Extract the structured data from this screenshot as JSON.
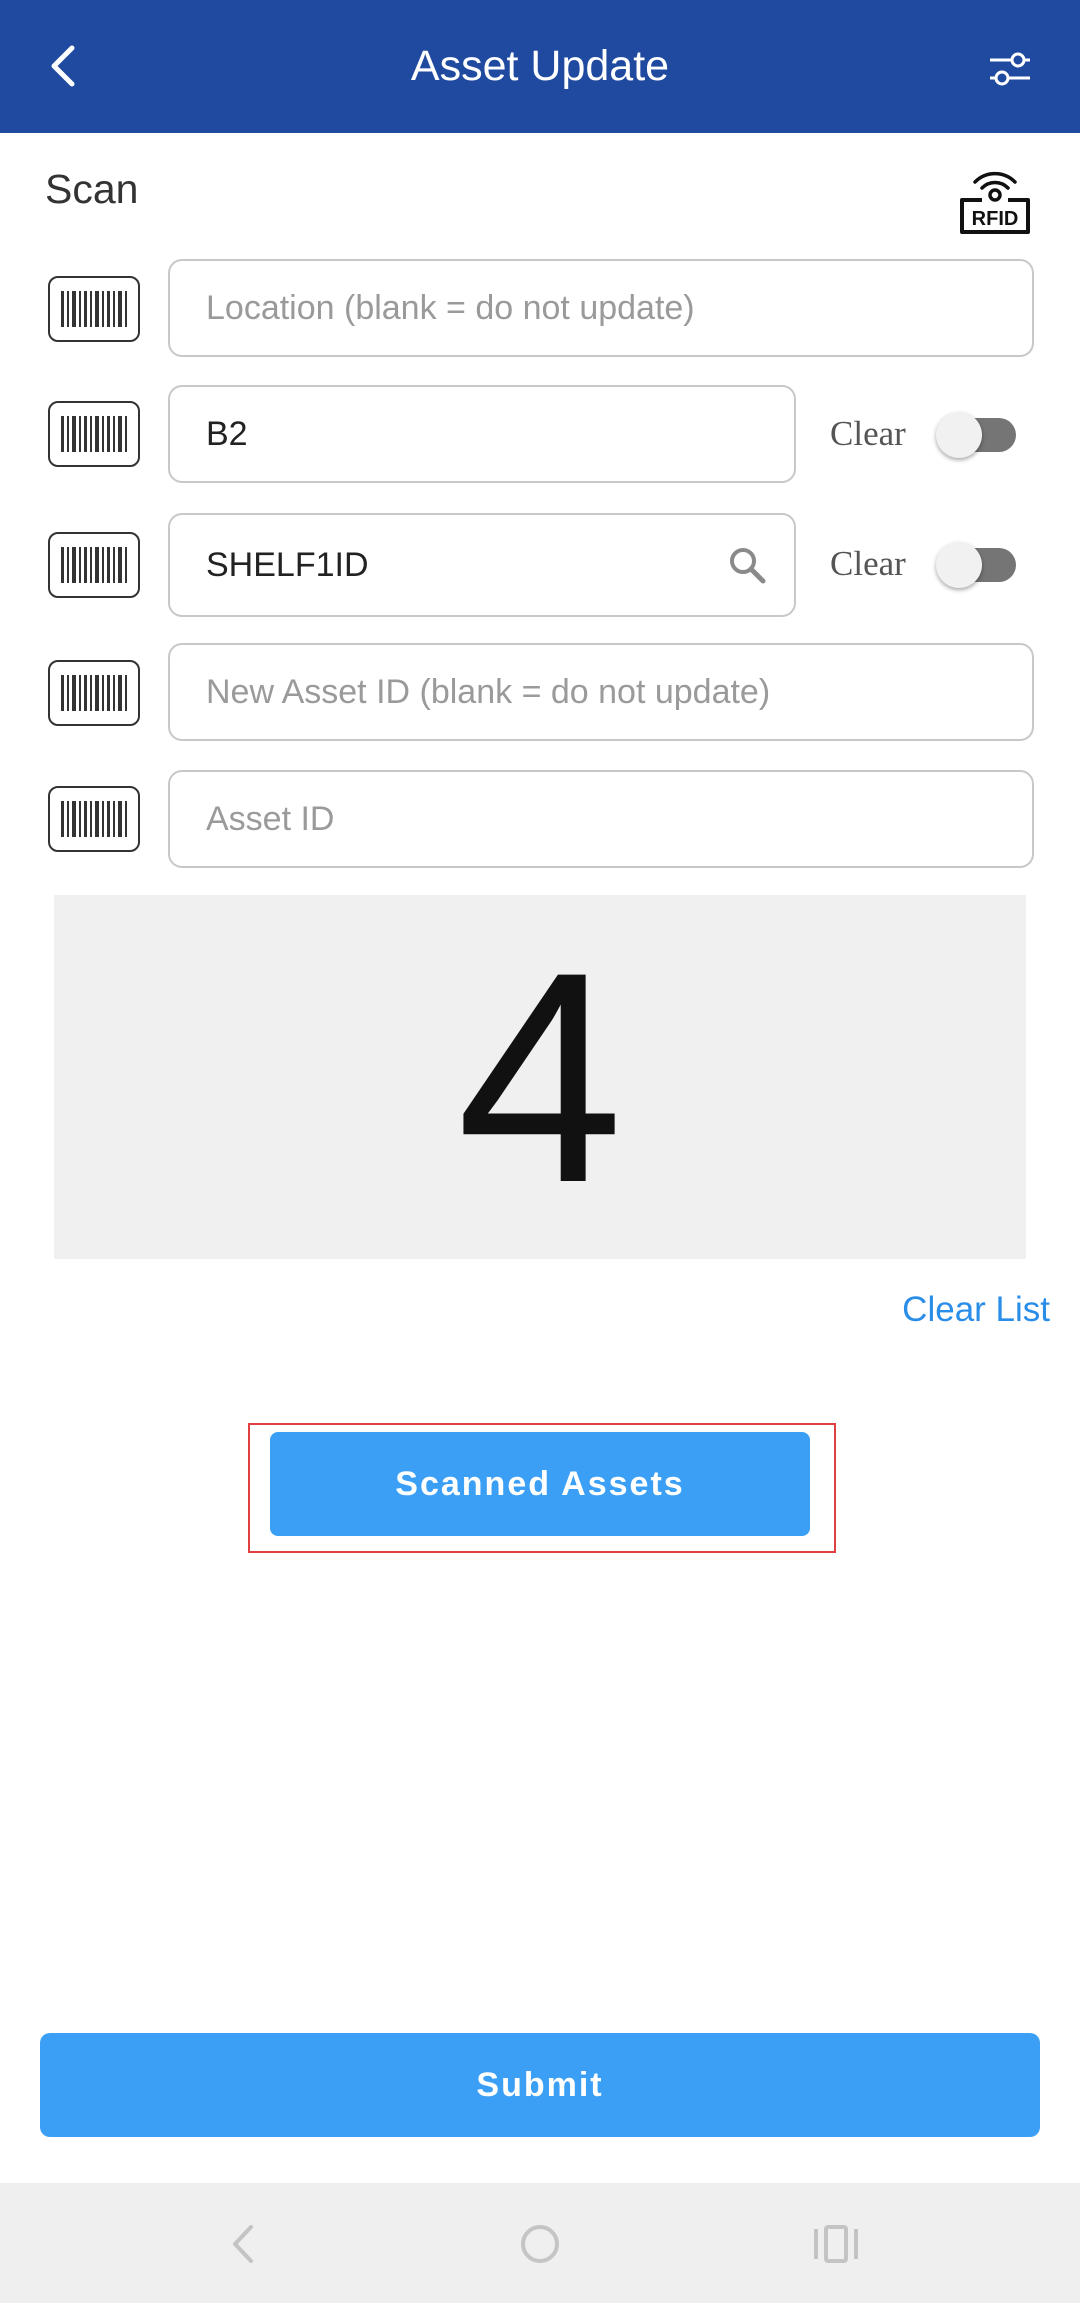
{
  "header": {
    "title": "Asset Update",
    "back_icon": "chevron-left-icon",
    "filter_icon": "sliders-icon",
    "background": "#1f4aa0"
  },
  "scan": {
    "label": "Scan",
    "rfid_icon": "rfid-icon",
    "rfid_text": "RFID"
  },
  "fields": {
    "location": {
      "placeholder": "Location (blank = do not update)",
      "value": ""
    },
    "sub_location": {
      "value": "B2",
      "clear_label": "Clear",
      "clear_toggle": false
    },
    "shelf": {
      "value": "SHELF1ID",
      "clear_label": "Clear",
      "clear_toggle": false
    },
    "new_asset": {
      "placeholder": "New Asset ID (blank = do not update)",
      "value": ""
    },
    "asset": {
      "placeholder": "Asset ID",
      "value": ""
    }
  },
  "counter": {
    "value": "4"
  },
  "actions": {
    "clear_list": "Clear List",
    "scanned_assets": "Scanned Assets",
    "submit": "Submit",
    "accent": "#3ba0f5",
    "link_color": "#2a8ee8",
    "highlight_color": "#e04040"
  },
  "navbar": {
    "back_icon": "nav-back-icon",
    "home_icon": "nav-home-icon",
    "recents_icon": "nav-recents-icon"
  }
}
